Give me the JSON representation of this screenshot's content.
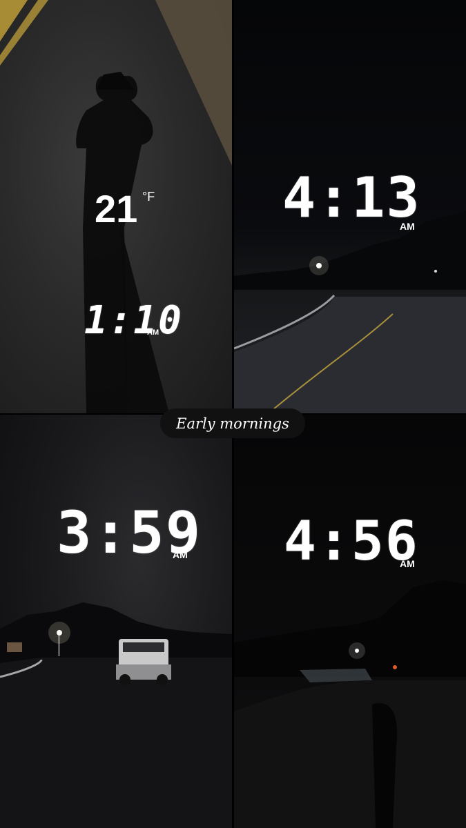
{
  "caption": "Early mornings",
  "panels": [
    {
      "temperature": "21",
      "temperature_unit": "°F",
      "time": "1:10",
      "period": "AM"
    },
    {
      "time": "4:13",
      "period": "AM"
    },
    {
      "time": "3:59",
      "period": "AM"
    },
    {
      "time": "4:56",
      "period": "AM"
    }
  ]
}
